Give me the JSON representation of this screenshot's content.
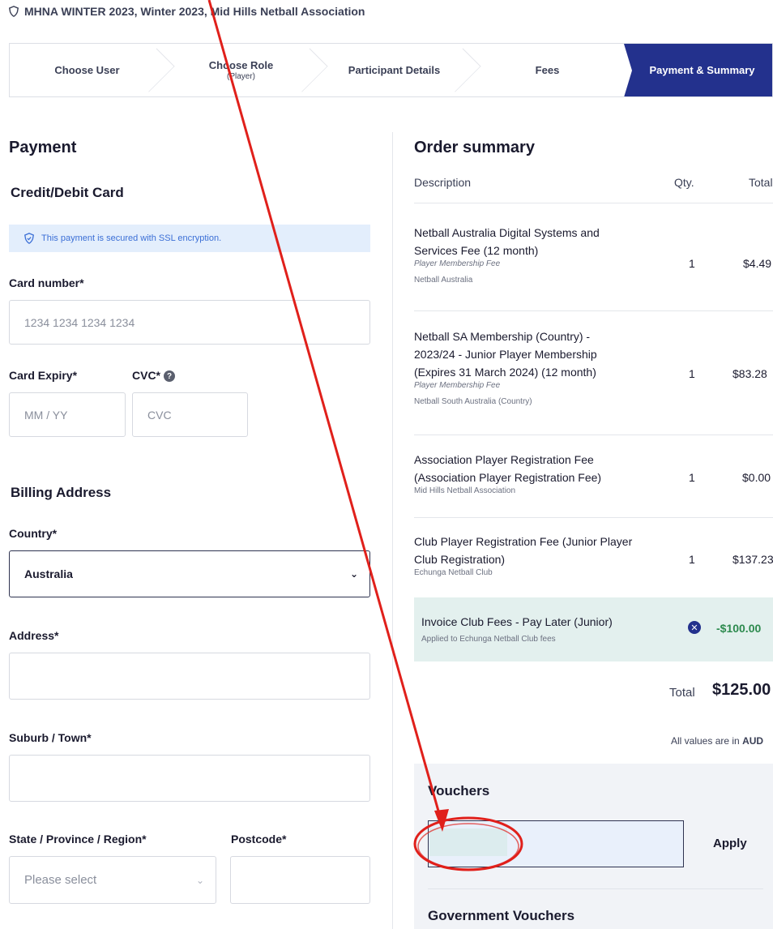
{
  "header": {
    "event_title": "MHNA WINTER 2023, Winter 2023, Mid Hills Netball Association"
  },
  "stepper": {
    "steps": [
      {
        "label": "Choose User",
        "sub": ""
      },
      {
        "label": "Choose Role",
        "sub": "(Player)"
      },
      {
        "label": "Participant Details",
        "sub": ""
      },
      {
        "label": "Fees",
        "sub": ""
      },
      {
        "label": "Payment & Summary",
        "sub": ""
      }
    ],
    "active_index": 4,
    "active_color": "#23318d"
  },
  "payment": {
    "title": "Payment",
    "method_title": "Credit/Debit Card",
    "ssl_notice": "This payment is secured with SSL encryption.",
    "card_number_label": "Card number*",
    "card_number_placeholder": "1234 1234 1234 1234",
    "card_expiry_label": "Card Expiry*",
    "card_expiry_placeholder": "MM / YY",
    "cvc_label": "CVC*",
    "cvc_placeholder": "CVC"
  },
  "billing": {
    "title": "Billing Address",
    "country_label": "Country*",
    "country_value": "Australia",
    "address_label": "Address*",
    "suburb_label": "Suburb / Town*",
    "state_label": "State / Province / Region*",
    "state_placeholder": "Please select",
    "postcode_label": "Postcode*"
  },
  "order_summary": {
    "title": "Order summary",
    "col_description": "Description",
    "col_qty": "Qty.",
    "col_total": "Total",
    "items": [
      {
        "desc_line1": "Netball Australia Digital Systems and",
        "desc_line2": "Services Fee (12 month)",
        "desc_line3": "",
        "sub": "Player Membership Fee",
        "org": "Netball Australia",
        "qty": "1",
        "total": "$4.49"
      },
      {
        "desc_line1": "Netball SA Membership (Country) -",
        "desc_line2": "2023/24 - Junior Player Membership",
        "desc_line3": "(Expires 31 March 2024) (12 month)",
        "sub": "Player Membership Fee",
        "org": "Netball South Australia (Country)",
        "qty": "1",
        "total": "$83.28"
      },
      {
        "desc_line1": "Association Player Registration Fee",
        "desc_line2": "(Association Player Registration Fee)",
        "desc_line3": "",
        "sub": "",
        "org": "Mid Hills Netball Association",
        "qty": "1",
        "total": "$0.00"
      },
      {
        "desc_line1": "Club Player Registration Fee (Junior Player",
        "desc_line2": "Club Registration)",
        "desc_line3": "",
        "sub": "",
        "org": "Echunga Netball Club",
        "qty": "1",
        "total": "$137.23"
      }
    ],
    "discount": {
      "title": "Invoice Club Fees - Pay Later (Junior)",
      "sub": "Applied to Echunga Netball Club fees",
      "amount": "-$100.00"
    },
    "total_label": "Total",
    "total_value": "$125.00",
    "currency_note": "All values are in",
    "currency": "AUD"
  },
  "vouchers": {
    "title": "Vouchers",
    "apply_label": "Apply",
    "input_value": "",
    "gov_title": "Government Vouchers"
  },
  "annotation": {
    "color": "#e0201b"
  }
}
